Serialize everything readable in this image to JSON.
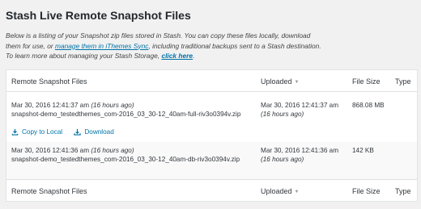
{
  "title": "Stash Live Remote Snapshot Files",
  "description": {
    "part1": "Below is a listing of your Snapshot zip files stored in Stash. You can copy these files locally, download",
    "part2": "them for use, or ",
    "link1": "manage them in iThemes Sync",
    "part3": ", including traditional backups sent to a Stash destination.",
    "part4": "To learn more about managing your Stash Storage, ",
    "link2": "click here",
    "part5": "."
  },
  "columns": {
    "file": "Remote Snapshot Files",
    "uploaded": "Uploaded",
    "size": "File Size",
    "type": "Type"
  },
  "rows": [
    {
      "date": "Mar 30, 2016 12:41:37 am",
      "ago": "(16 hours ago)",
      "filename": "snapshot-demo_testedthemes_com-2016_03_30-12_40am-full-riv3o0394v.zip",
      "uploaded_date": "Mar 30, 2016 12:41:37 am",
      "uploaded_ago": "(16 hours ago)",
      "size": "868.08 MB",
      "type": "",
      "actions": {
        "copy": "Copy to Local",
        "download": "Download"
      }
    },
    {
      "date": "Mar 30, 2016 12:41:36 am",
      "ago": "(16 hours ago)",
      "filename": "snapshot-demo_testedthemes_com-2016_03_30-12_40am-db-riv3o0394v.zip",
      "uploaded_date": "Mar 30, 2016 12:41:36 am",
      "uploaded_ago": "(16 hours ago)",
      "size": "142 KB",
      "type": ""
    }
  ],
  "colors": {
    "link": "#0073aa",
    "text": "#32373c",
    "background": "#f1f1f1"
  },
  "icons": {
    "copy": "copy-icon",
    "download": "download-icon",
    "sort": "sort-arrow-icon"
  }
}
